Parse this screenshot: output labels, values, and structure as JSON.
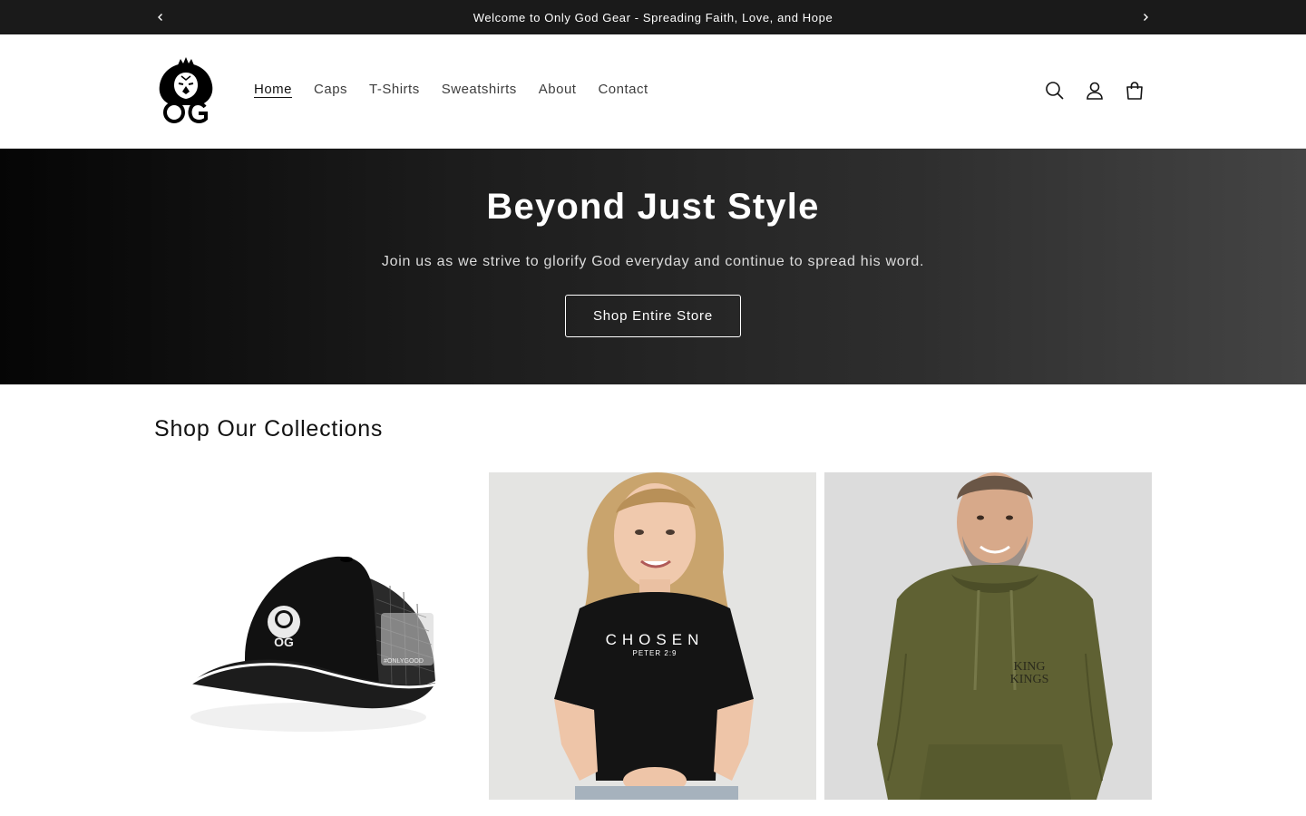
{
  "announcement": {
    "message": "Welcome to Only God Gear - Spreading Faith, Love, and Hope",
    "prev_icon": "chevron-left-icon",
    "next_icon": "chevron-right-icon"
  },
  "header": {
    "logo": {
      "icon": "lion-og-logo",
      "text": "OG"
    },
    "nav": [
      {
        "label": "Home",
        "active": true
      },
      {
        "label": "Caps"
      },
      {
        "label": "T-Shirts"
      },
      {
        "label": "Sweatshirts"
      },
      {
        "label": "About"
      },
      {
        "label": "Contact"
      }
    ],
    "icons": [
      "search-icon",
      "account-icon",
      "cart-icon"
    ]
  },
  "hero": {
    "title": "Beyond Just Style",
    "subtitle": "Join us as we strive to glorify God everyday and continue to spread his word.",
    "cta_label": "Shop Entire Store"
  },
  "collections": {
    "title": "Shop Our Collections",
    "items": [
      {
        "name": "caps",
        "print": "#ONLYGOOD"
      },
      {
        "name": "t-shirts",
        "print_line1": "CHOSEN",
        "print_line2": "PETER 2:9"
      },
      {
        "name": "sweatshirts",
        "print_line1": "KING",
        "print_line2": "KINGS"
      }
    ]
  },
  "colors": {
    "announcement_bg": "#1a1a1a",
    "hero_gradient_start": "#050505",
    "hero_gradient_end": "#444444",
    "text": "#121212"
  }
}
